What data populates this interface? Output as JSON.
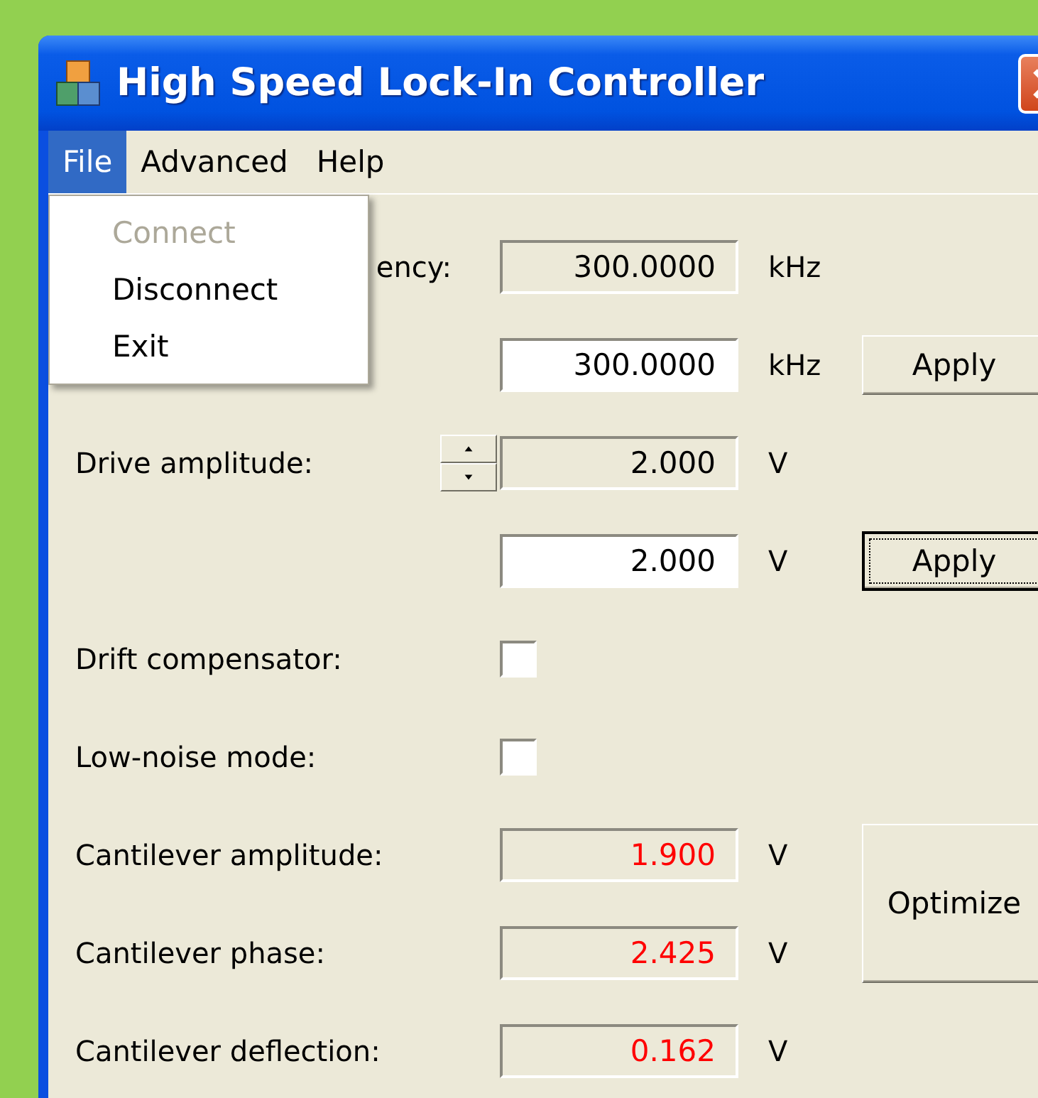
{
  "window": {
    "title": "High Speed Lock-In Controller"
  },
  "menu_bar": [
    {
      "label": "File",
      "selected": true
    },
    {
      "label": "Advanced",
      "selected": false
    },
    {
      "label": "Help",
      "selected": false
    }
  ],
  "file_menu": [
    {
      "label": "Connect",
      "disabled": true
    },
    {
      "label": "Disconnect",
      "disabled": false
    },
    {
      "label": "Exit",
      "disabled": false
    }
  ],
  "rows": [
    {
      "kind": "readout",
      "label": "ency:",
      "covered": true,
      "value": "300.0000",
      "unit": "kHz"
    },
    {
      "kind": "entry",
      "value": "300.0000",
      "unit": "kHz",
      "button": {
        "label": "Apply",
        "focused": false
      }
    },
    {
      "kind": "readout",
      "label": "Drive amplitude:",
      "spinner": true,
      "value": "2.000",
      "unit": "V"
    },
    {
      "kind": "entry",
      "value": "2.000",
      "unit": "V",
      "button": {
        "label": "Apply",
        "focused": true
      }
    },
    {
      "kind": "check",
      "label": "Drift compensator:",
      "checked": false
    },
    {
      "kind": "check",
      "label": "Low-noise mode:",
      "checked": false
    },
    {
      "kind": "measure",
      "label": "Cantilever amplitude:",
      "value": "1.900",
      "unit": "V"
    },
    {
      "kind": "measure",
      "label": "Cantilever phase:",
      "value": "2.425",
      "unit": "V"
    },
    {
      "kind": "measure",
      "label": "Cantilever deflection:",
      "value": "0.162",
      "unit": "V"
    }
  ],
  "optimize_button": {
    "label": "Optimize"
  }
}
